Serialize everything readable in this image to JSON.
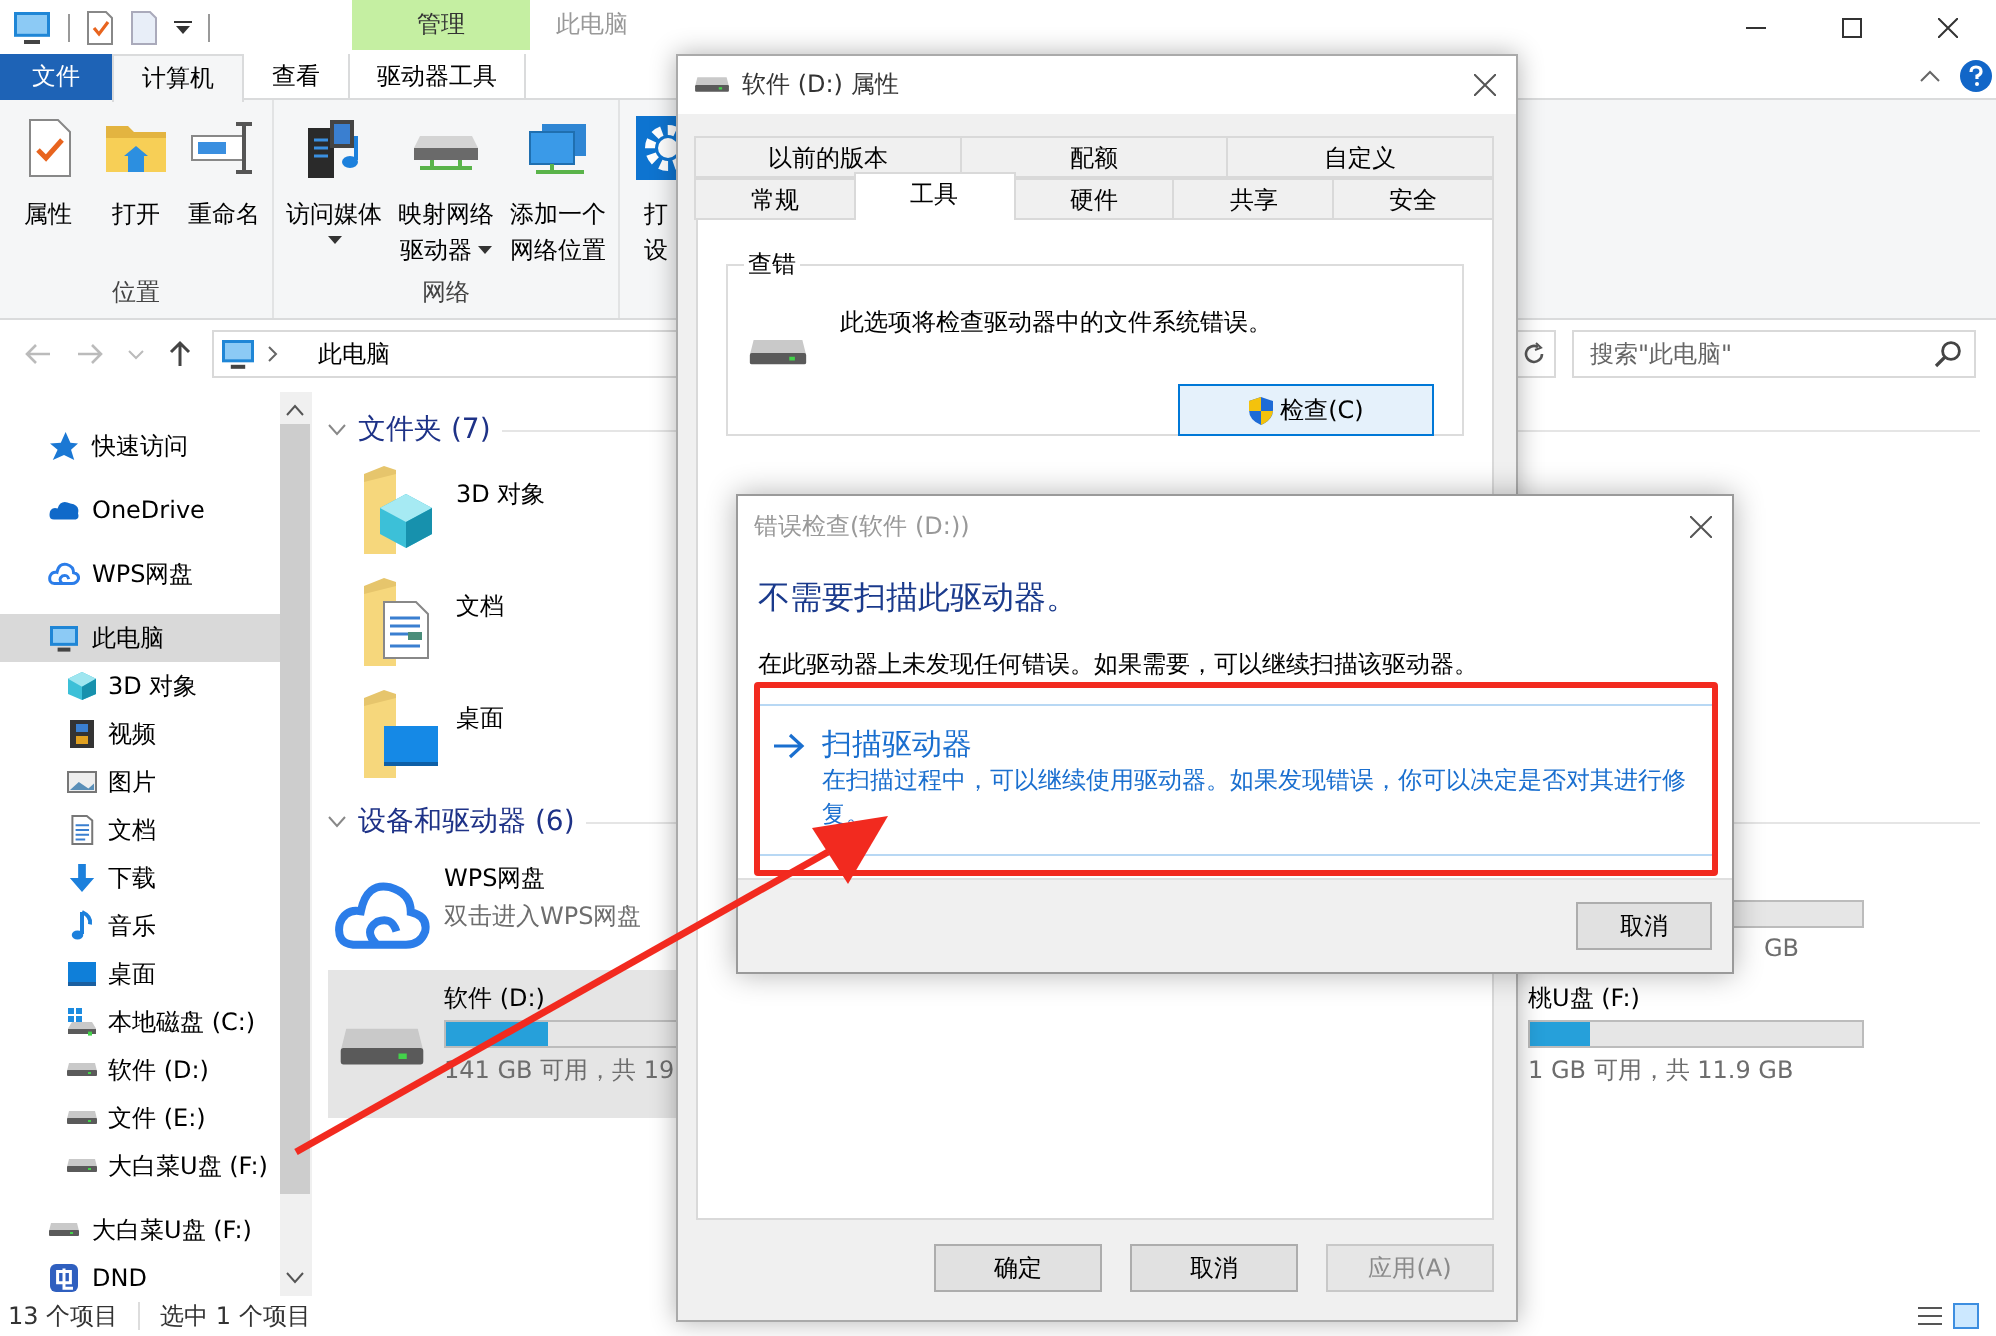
{
  "title_bar": {
    "context_tab": "管理",
    "title": "此电脑"
  },
  "ribbon_tabs": [
    {
      "label": "文件",
      "kind": "file",
      "selected": false
    },
    {
      "label": "计算机",
      "kind": "tab",
      "selected": true
    },
    {
      "label": "查看",
      "kind": "tab",
      "selected": false
    },
    {
      "label": "驱动器工具",
      "kind": "context",
      "selected": false
    }
  ],
  "ribbon_groups": [
    {
      "label": "位置",
      "commands": [
        {
          "lines": [
            "属性"
          ],
          "kind": "properties",
          "has_menu": false
        },
        {
          "lines": [
            "打开"
          ],
          "kind": "open",
          "has_menu": false
        },
        {
          "lines": [
            "重命名"
          ],
          "kind": "rename",
          "has_menu": false
        }
      ]
    },
    {
      "label": "网络",
      "commands": [
        {
          "lines": [
            "访问媒体"
          ],
          "kind": "media",
          "has_menu": true
        },
        {
          "lines": [
            "映射网络",
            "驱动器"
          ],
          "kind": "netdrive",
          "has_menu": true
        },
        {
          "lines": [
            "添加一个",
            "网络位置"
          ],
          "kind": "netlocation",
          "has_menu": false
        }
      ]
    },
    {
      "commands": [
        {
          "lines": [
            "打",
            "设"
          ],
          "kind": "settings",
          "has_menu": false
        }
      ]
    }
  ],
  "address_bar": {
    "path": "此电脑"
  },
  "search": {
    "placeholder": "搜索\"此电脑\""
  },
  "navigation": [
    {
      "label": "快速访问",
      "kind": "star",
      "selected": false
    },
    {
      "label": "OneDrive",
      "kind": "onedrive",
      "selected": false
    },
    {
      "label": "WPS网盘",
      "kind": "cloud",
      "selected": false
    },
    {
      "label": "此电脑",
      "kind": "pc",
      "selected": true,
      "children": [
        {
          "label": "3D 对象",
          "kind": "cube",
          "selected": false
        },
        {
          "label": "视频",
          "kind": "video",
          "selected": false
        },
        {
          "label": "图片",
          "kind": "picture",
          "selected": false
        },
        {
          "label": "文档",
          "kind": "document",
          "selected": false
        },
        {
          "label": "下载",
          "kind": "download",
          "selected": false
        },
        {
          "label": "音乐",
          "kind": "music",
          "selected": false
        },
        {
          "label": "桌面",
          "kind": "desktop",
          "selected": false
        },
        {
          "label": "本地磁盘 (C:)",
          "kind": "system-drive",
          "selected": false
        },
        {
          "label": "软件 (D:)",
          "kind": "drive",
          "selected": false
        },
        {
          "label": "文件 (E:)",
          "kind": "drive",
          "selected": false
        },
        {
          "label": "大白菜U盘 (F:)",
          "kind": "drive",
          "selected": false
        }
      ]
    },
    {
      "label": "大白菜U盘 (F:)",
      "kind": "drive",
      "selected": false
    },
    {
      "label": "DND",
      "kind": "dnd",
      "selected": false
    }
  ],
  "sections": [
    {
      "title": "文件夹 (7)",
      "expanded": true,
      "kind": "folders",
      "items": [
        {
          "name": "3D 对象",
          "kind": "cube"
        },
        {
          "name": "文档",
          "kind": "document"
        },
        {
          "name": "桌面",
          "kind": "desktop"
        }
      ]
    },
    {
      "title": "设备和驱动器 (6)",
      "expanded": true,
      "kind": "drives",
      "items": [
        {
          "name": "WPS网盘",
          "detail": "双击进入WPS网盘",
          "kind": "cloud",
          "selected": false
        },
        {
          "name": "软件 (D:)",
          "detail": "141 GB 可用，共 19",
          "kind": "drive",
          "level": 0.31,
          "selected": true
        },
        {
          "detail": "GB",
          "kind": "drive",
          "selected": false
        },
        {
          "name": "桃U盘 (F:)",
          "detail": "1 GB 可用，共 11.9 GB",
          "kind": "drive",
          "level": 0.18,
          "selected": false
        }
      ]
    }
  ],
  "status_bar": {
    "count": "13 个项目",
    "selection": "选中 1 个项目"
  },
  "properties_dialog": {
    "title": "软件 (D:) 属性",
    "tab_rows": [
      [
        {
          "label": "以前的版本",
          "selected": false
        },
        {
          "label": "配额",
          "selected": false
        },
        {
          "label": "自定义",
          "selected": false
        }
      ],
      [
        {
          "label": "常规",
          "selected": false
        },
        {
          "label": "工具",
          "selected": true
        },
        {
          "label": "硬件",
          "selected": false
        },
        {
          "label": "共享",
          "selected": false
        },
        {
          "label": "安全",
          "selected": false
        }
      ]
    ],
    "error_checking": {
      "title": "查错",
      "text": "此选项将检查驱动器中的文件系统错误。",
      "button": "检查(C)"
    },
    "buttons": [
      {
        "label": "确定",
        "disabled": false
      },
      {
        "label": "取消",
        "disabled": false
      },
      {
        "label": "应用(A)",
        "disabled": true
      }
    ]
  },
  "error_dialog": {
    "title": "错误检查(软件 (D:))",
    "heading": "不需要扫描此驱动器。",
    "message": "在此驱动器上未发现任何错误。如果需要，可以继续扫描该驱动器。",
    "command": {
      "title": "扫描驱动器",
      "description": "在扫描过程中，可以继续使用驱动器。如果发现错误，你可以决定是否对其进行修复。"
    },
    "buttons": [
      {
        "label": "取消",
        "disabled": false
      }
    ]
  },
  "annotations": {
    "highlight_box": true,
    "arrow": true
  }
}
